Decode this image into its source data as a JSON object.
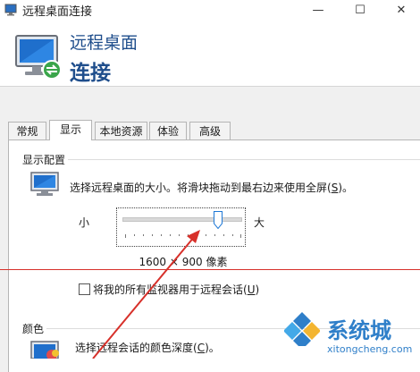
{
  "window": {
    "title": "远程桌面连接",
    "minimize_glyph": "—",
    "maximize_glyph": "☐",
    "close_glyph": "✕"
  },
  "header": {
    "subtitle": "远程桌面",
    "title": "连接"
  },
  "tabs": [
    {
      "label": "常规",
      "active": false
    },
    {
      "label": "显示",
      "active": true
    },
    {
      "label": "本地资源",
      "active": false
    },
    {
      "label": "体验",
      "active": false
    },
    {
      "label": "高级",
      "active": false
    }
  ],
  "display_config": {
    "group_label": "显示配置",
    "description_prefix": "选择远程桌面的大小。将滑块拖动到最右边来使用全屏(",
    "description_key": "S",
    "description_suffix": ")。",
    "slider_min_label": "小",
    "slider_max_label": "大",
    "slider_value": 0.8,
    "resolution": "1600 × 900 像素",
    "multi_monitor_prefix": "将我的所有监视器用于远程会话(",
    "multi_monitor_key": "U",
    "multi_monitor_suffix": ")",
    "multi_monitor_checked": false
  },
  "colors": {
    "group_label": "颜色",
    "description_prefix": "选择远程会话的颜色深度(",
    "description_key": "C",
    "description_suffix": ")。"
  },
  "watermark": {
    "name": "系统城",
    "url": "xitongcheng.com"
  },
  "accent": {
    "title_blue": "#1f4e8c",
    "annotation_red": "#d7302a",
    "watermark_blue": "#2f7fc9"
  }
}
